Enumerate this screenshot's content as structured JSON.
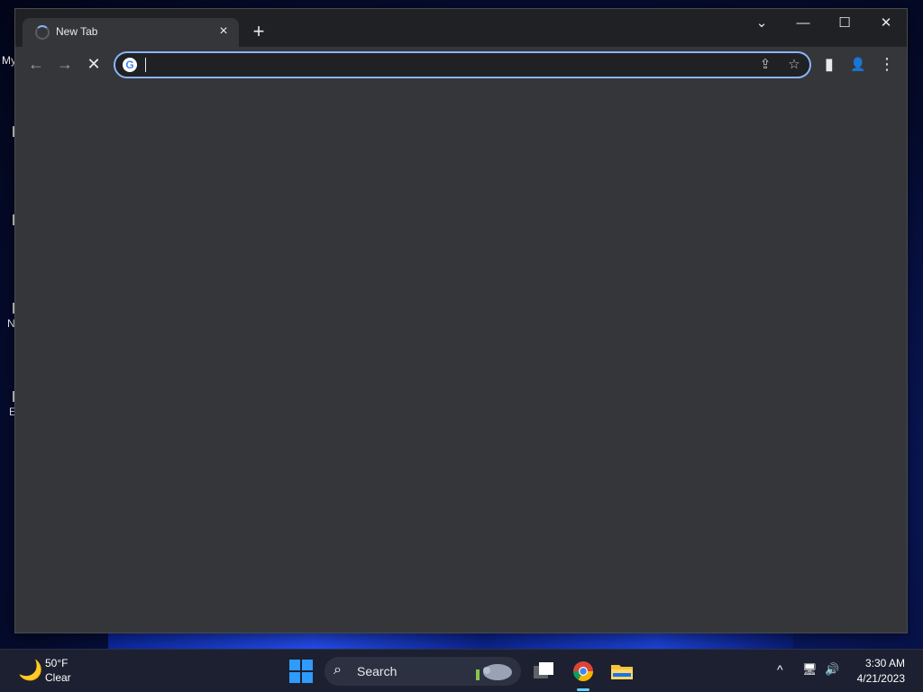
{
  "desktop": {
    "fragments": [
      "My",
      "N",
      "E"
    ]
  },
  "browser": {
    "tab": {
      "title": "New Tab",
      "close_icon": "×"
    },
    "new_tab_icon": "+",
    "window_controls": {
      "tab_search": "⌄",
      "minimize": "—",
      "maximize": "☐",
      "close": "✕"
    },
    "toolbar": {
      "back_icon": "←",
      "forward_icon": "→",
      "stop_icon": "✕",
      "share_icon": "⇪",
      "bookmark_icon": "☆",
      "side_panel_icon": "▮",
      "profile_icon": "👤",
      "menu_icon": "⋮"
    },
    "omnibox": {
      "value": "",
      "placeholder": "",
      "logo": "G"
    }
  },
  "taskbar": {
    "weather": {
      "temp": "50°F",
      "desc": "Clear",
      "icon": "moon-icon"
    },
    "search": {
      "label": "Search"
    },
    "tray": {
      "chevron": "^",
      "network_icon": "🖥",
      "volume_icon": "🔊"
    },
    "clock": {
      "time": "3:30 AM",
      "date": "4/21/2023"
    }
  }
}
